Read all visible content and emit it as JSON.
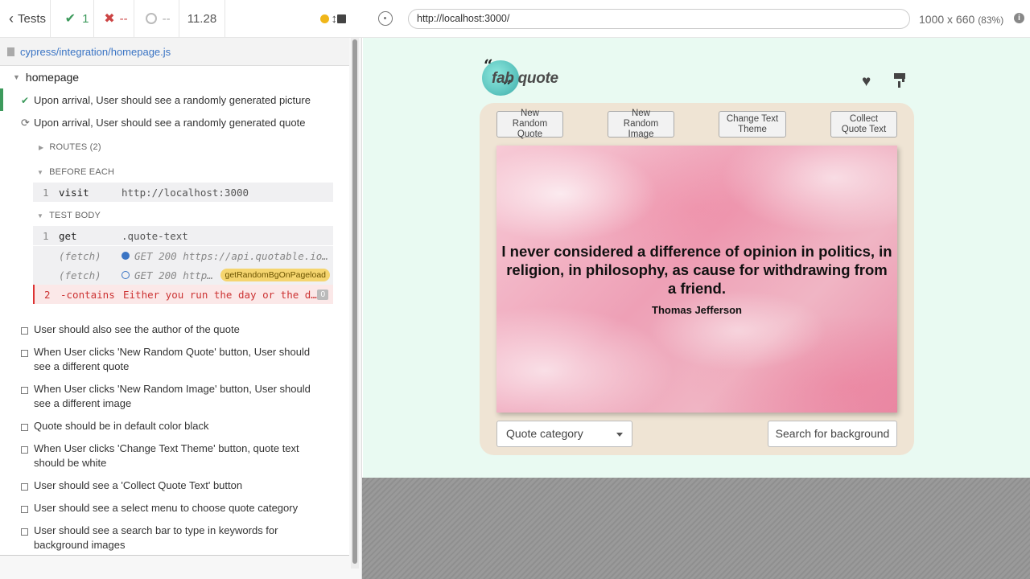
{
  "runner": {
    "back_label": "Tests",
    "passed": "1",
    "failed": "--",
    "pending": "--",
    "duration": "11.28",
    "spec_file": "cypress/integration/homepage.js"
  },
  "reporter": {
    "suite": "homepage",
    "tests": [
      "Upon arrival, User should see a randomly generated picture",
      "Upon arrival, User should see a randomly generated quote"
    ],
    "routes_label": "ROUTES (2)",
    "before_each_label": "BEFORE EACH",
    "test_body_label": "TEST BODY",
    "commands": [
      {
        "num": "1",
        "name": "visit",
        "msg": "http://localhost:3000"
      },
      {
        "num": "1",
        "name": "get",
        "msg": ".quote-text"
      },
      {
        "num": "",
        "name": "(fetch)",
        "msg": "GET 200 https://api.quotable.io..."
      },
      {
        "num": "",
        "name": "(fetch)",
        "msg": "GET 200 http...",
        "alias": "getRandomBgOnPageload"
      },
      {
        "num": "2",
        "name": "-contains",
        "msg": "Either you run the day or the da...",
        "badge": "0"
      }
    ],
    "pending_tests": [
      "User should also see the author of the quote",
      "When User clicks 'New Random Quote' button, User should see a different quote",
      "When User clicks 'New Random Image' button, User should see a different image",
      "Quote should be in default color black",
      "When User clicks 'Change Text Theme' button, quote text should be white",
      "User should see a 'Collect Quote Text' button",
      "User should see a select menu to choose quote category",
      "User should see a search bar to type in keywords for background images"
    ]
  },
  "browser": {
    "url": "http://localhost:3000/",
    "viewport": "1000 x 660",
    "scale": "(83%)"
  },
  "app": {
    "logo_text": "fab quote",
    "buttons": [
      "New Random Quote",
      "New Random Image",
      "Change Text Theme",
      "Collect Quote Text"
    ],
    "quote": "I never considered a difference of opinion in politics, in religion, in philosophy, as cause for withdrawing from a friend.",
    "author": "Thomas Jefferson",
    "category_select": "Quote category",
    "search_button": "Search for background"
  },
  "colors": {
    "pass": "#3d9a5c",
    "fail": "#cc3333",
    "app_bg": "#e9faf2",
    "card_bg": "#efe4d4"
  }
}
